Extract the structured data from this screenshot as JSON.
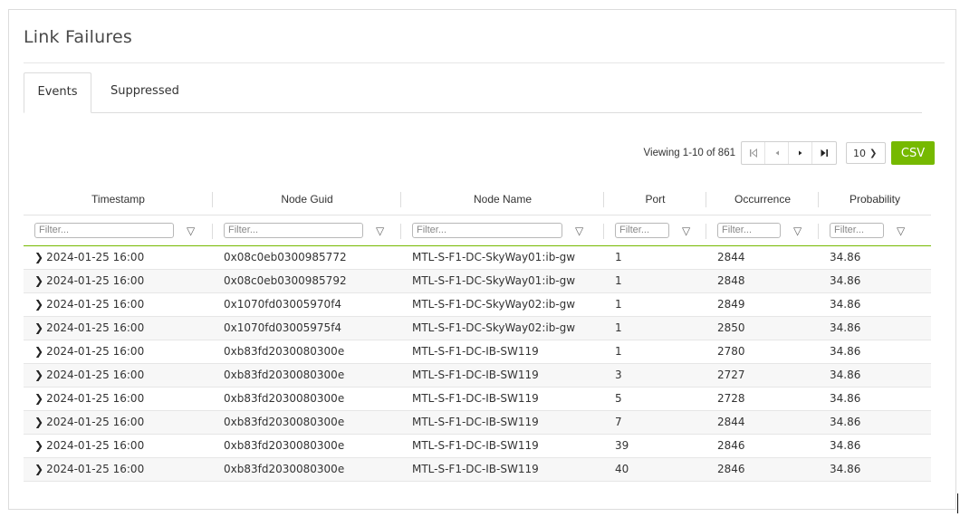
{
  "panel": {
    "title": "Link Failures"
  },
  "tabs": [
    {
      "label": "Events",
      "active": true
    },
    {
      "label": "Suppressed",
      "active": false
    }
  ],
  "toolbar": {
    "viewing": "Viewing 1-10 of 861",
    "page_size": "10",
    "csv_label": "CSV",
    "csv_color": "#76b900"
  },
  "columns": [
    "Timestamp",
    "Node Guid",
    "Node Name",
    "Port",
    "Occurrence",
    "Probability"
  ],
  "filter_placeholder": "Filter...",
  "rows": [
    {
      "timestamp": "2024-01-25 16:00",
      "guid": "0x08c0eb0300985772",
      "name": "MTL-S-F1-DC-SkyWay01:ib-gw",
      "port": "1",
      "occurrence": "2844",
      "probability": "34.86"
    },
    {
      "timestamp": "2024-01-25 16:00",
      "guid": "0x08c0eb0300985792",
      "name": "MTL-S-F1-DC-SkyWay01:ib-gw",
      "port": "1",
      "occurrence": "2848",
      "probability": "34.86"
    },
    {
      "timestamp": "2024-01-25 16:00",
      "guid": "0x1070fd03005970f4",
      "name": "MTL-S-F1-DC-SkyWay02:ib-gw",
      "port": "1",
      "occurrence": "2849",
      "probability": "34.86"
    },
    {
      "timestamp": "2024-01-25 16:00",
      "guid": "0x1070fd03005975f4",
      "name": "MTL-S-F1-DC-SkyWay02:ib-gw",
      "port": "1",
      "occurrence": "2850",
      "probability": "34.86"
    },
    {
      "timestamp": "2024-01-25 16:00",
      "guid": "0xb83fd2030080300e",
      "name": "MTL-S-F1-DC-IB-SW119",
      "port": "1",
      "occurrence": "2780",
      "probability": "34.86"
    },
    {
      "timestamp": "2024-01-25 16:00",
      "guid": "0xb83fd2030080300e",
      "name": "MTL-S-F1-DC-IB-SW119",
      "port": "3",
      "occurrence": "2727",
      "probability": "34.86"
    },
    {
      "timestamp": "2024-01-25 16:00",
      "guid": "0xb83fd2030080300e",
      "name": "MTL-S-F1-DC-IB-SW119",
      "port": "5",
      "occurrence": "2728",
      "probability": "34.86"
    },
    {
      "timestamp": "2024-01-25 16:00",
      "guid": "0xb83fd2030080300e",
      "name": "MTL-S-F1-DC-IB-SW119",
      "port": "7",
      "occurrence": "2844",
      "probability": "34.86"
    },
    {
      "timestamp": "2024-01-25 16:00",
      "guid": "0xb83fd2030080300e",
      "name": "MTL-S-F1-DC-IB-SW119",
      "port": "39",
      "occurrence": "2846",
      "probability": "34.86"
    },
    {
      "timestamp": "2024-01-25 16:00",
      "guid": "0xb83fd2030080300e",
      "name": "MTL-S-F1-DC-IB-SW119",
      "port": "40",
      "occurrence": "2846",
      "probability": "34.86"
    }
  ]
}
